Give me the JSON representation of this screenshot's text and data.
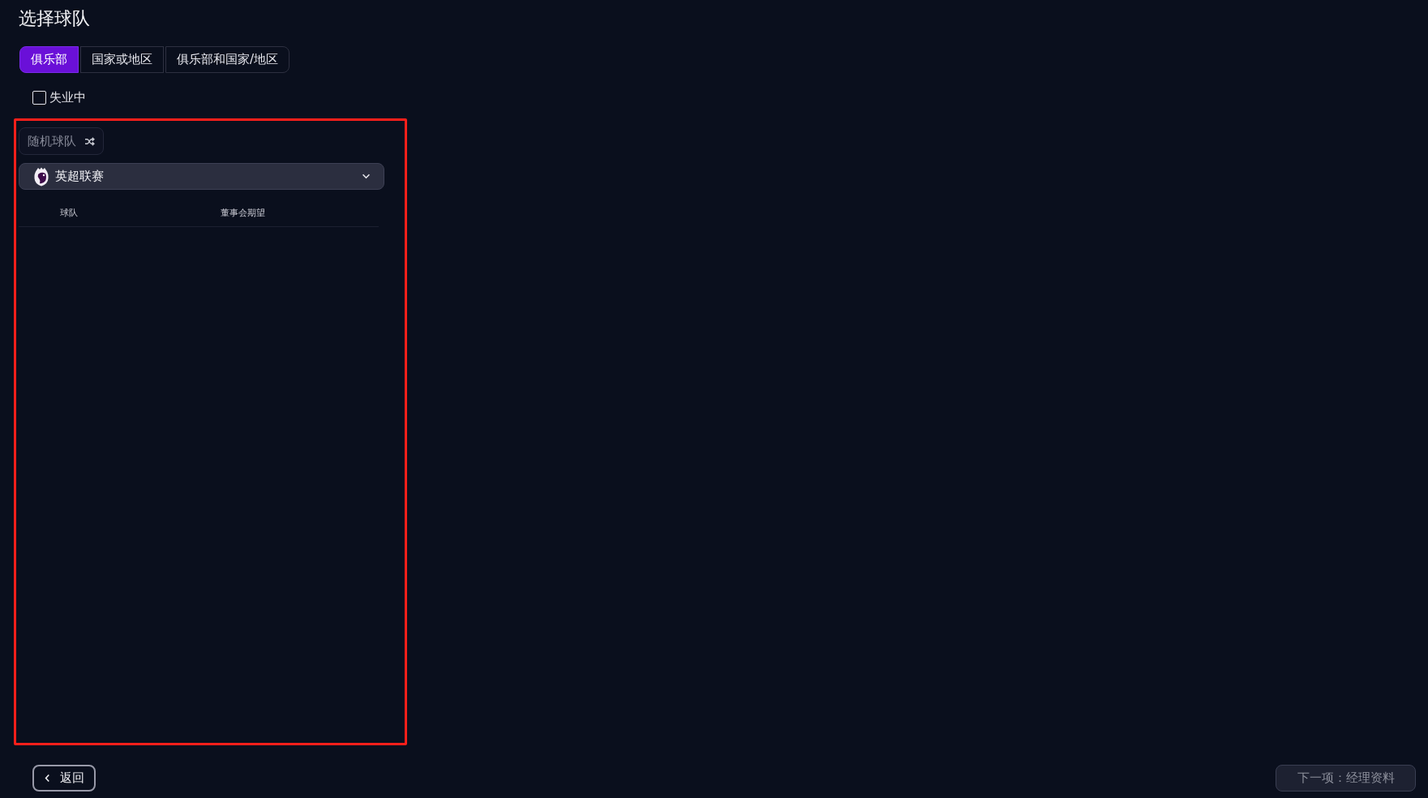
{
  "title": "选择球队",
  "tabs": [
    {
      "label": "俱乐部",
      "selected": true
    },
    {
      "label": "国家或地区",
      "selected": false
    },
    {
      "label": "俱乐部和国家/地区",
      "selected": false
    }
  ],
  "unemployed_filter": {
    "label": "失业中",
    "checked": false
  },
  "random_team_button": {
    "label": "随机球队"
  },
  "league_dropdown": {
    "value": "英超联赛"
  },
  "table": {
    "columns": [
      "球队",
      "董事会期望"
    ]
  },
  "back_button": {
    "label": "返回"
  },
  "next_button": {
    "label": "下一项：经理资料",
    "disabled": true
  }
}
